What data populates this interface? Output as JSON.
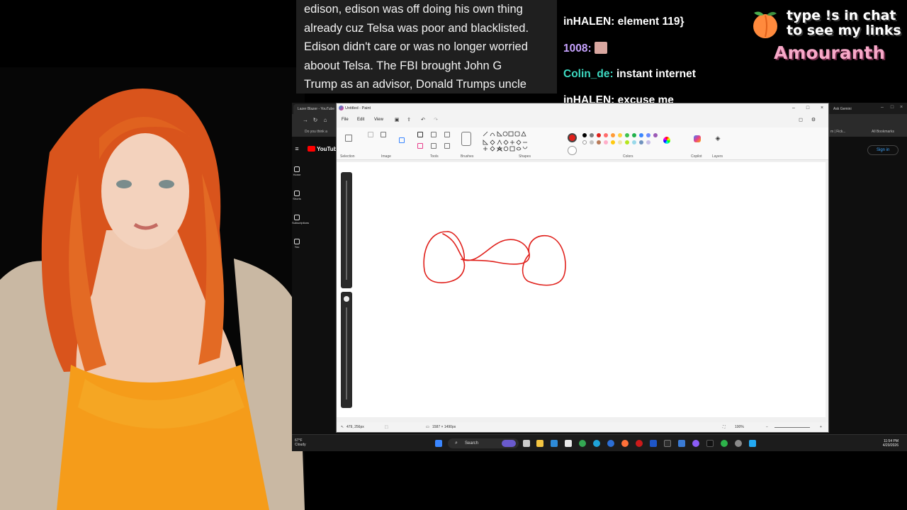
{
  "caption": {
    "lines": [
      "edison, edison was off doing his own thing",
      "already cuz Telsa was poor and blacklisted.",
      "Edison didn't care or was no longer worried",
      "aboout Telsa. The FBI brought John G",
      "Trump as an advisor, Donald Trumps uncle"
    ]
  },
  "chat": {
    "messages": [
      {
        "user": "inHALEN:",
        "text": "element 119}",
        "color": "#ffffff"
      },
      {
        "user": "1008:",
        "text": "",
        "color": "#c7a3ff",
        "emote": true
      },
      {
        "user": "Colin_de:",
        "text": "instant internet",
        "color": "#3dd9c1"
      },
      {
        "user": "inHALEN:",
        "text": "excuse me",
        "color": "#ffffff"
      }
    ]
  },
  "promo": {
    "line1": "type !s in chat",
    "line2": "to see my links",
    "brand": "Amouranth",
    "icon": "peach-icon"
  },
  "browser": {
    "tab_title": "Lazer Blazer - YouTube",
    "ask_label": "Ask Gemini",
    "bookmark_item": "Do you think a",
    "bookmarks_right": "All Bookmarks",
    "bookmark_mid": "m | Fick...",
    "yt_logo": "YouTube",
    "nav": [
      "Home",
      "Shorts",
      "Subscriptions",
      "You"
    ],
    "signin": "Sign in"
  },
  "paint": {
    "title": "Untitled - Paint",
    "menu": [
      "File",
      "Edit",
      "View"
    ],
    "groups": [
      "Selection",
      "Image",
      "Tools",
      "Brushes",
      "Shapes",
      "Colors",
      "Copilot",
      "Layers"
    ],
    "status_position": "479, 256px",
    "status_size": "1587 × 1490px",
    "zoom": "100%",
    "stroke_color": "#e0201b",
    "palette": [
      "#000000",
      "#7f7f7f",
      "#e0201b",
      "#ff6b6b",
      "#ff9b36",
      "#ffd23f",
      "#3fc24d",
      "#22b14c",
      "#3a86ff",
      "#9b59b6",
      "#ffffff",
      "#c3c3c3"
    ]
  },
  "taskbar": {
    "temp": "67°F",
    "weather": "Cloudy",
    "search": "Search",
    "time": "11:54 PM",
    "date": "4/20/2026"
  }
}
